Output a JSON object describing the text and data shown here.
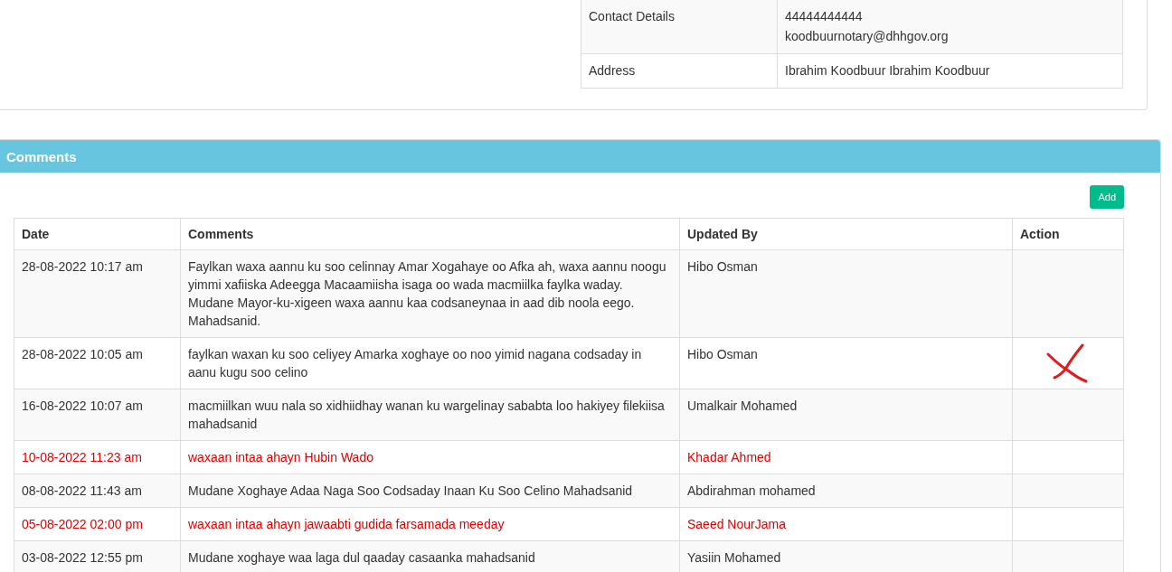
{
  "details": [
    {
      "label": "Contact Details",
      "values": [
        "44444444444",
        "koodbuurnotary@dhhgov.org"
      ]
    },
    {
      "label": "Address",
      "values": [
        "Ibrahim Koodbuur Ibrahim Koodbuur"
      ]
    }
  ],
  "comments_panel": {
    "title": "Comments",
    "add_button": "Add",
    "table": {
      "columns": [
        "Date",
        "Comments",
        "Updated By",
        "Action"
      ],
      "rows": [
        {
          "date": "28-08-2022 10:17 am",
          "comment": "Faylkan waxa aannu ku soo celinnay Amar Xogahaye oo Afka ah, waxa aannu noogu yimmi xafiiska Adeegga Macaamiisha isaga oo wada macmiilka faylka waday. Mudane Mayor-ku-xigeen waxa aannu kaa codsaneynaa in aad dib noola eego. Mahadsanid.",
          "updated_by": "Hibo Osman",
          "highlighted": false,
          "marked": false
        },
        {
          "date": "28-08-2022 10:05 am",
          "comment": "faylkan waxan ku soo celiyey Amarka xoghaye oo noo yimid nagana codsaday in aanu kugu soo celino",
          "updated_by": "Hibo Osman",
          "highlighted": false,
          "marked": true
        },
        {
          "date": "16-08-2022 10:07 am",
          "comment": "macmiilkan wuu nala so xidhiidhay wanan ku wargelinay sababta loo hakiyey filekiisa mahadsanid",
          "updated_by": "Umalkair Mohamed",
          "highlighted": false,
          "marked": false
        },
        {
          "date": "10-08-2022 11:23 am",
          "comment": "waxaan intaa ahayn Hubin Wado",
          "updated_by": "Khadar Ahmed",
          "highlighted": true,
          "marked": false
        },
        {
          "date": "08-08-2022 11:43 am",
          "comment": "Mudane Xoghaye Adaa Naga Soo Codsaday Inaan Ku Soo Celino Mahadsanid",
          "updated_by": "Abdirahman mohamed",
          "highlighted": false,
          "marked": false
        },
        {
          "date": "05-08-2022 02:00 pm",
          "comment": "waxaan intaa ahayn jawaabti gudida farsamada meeday",
          "updated_by": "Saeed NourJama",
          "highlighted": true,
          "marked": false
        },
        {
          "date": "03-08-2022 12:55 pm",
          "comment": "Mudane xoghaye waa laga dul qaaday casaanka mahadsanid",
          "updated_by": "Yasiin Mohamed",
          "highlighted": false,
          "marked": false
        }
      ]
    }
  }
}
